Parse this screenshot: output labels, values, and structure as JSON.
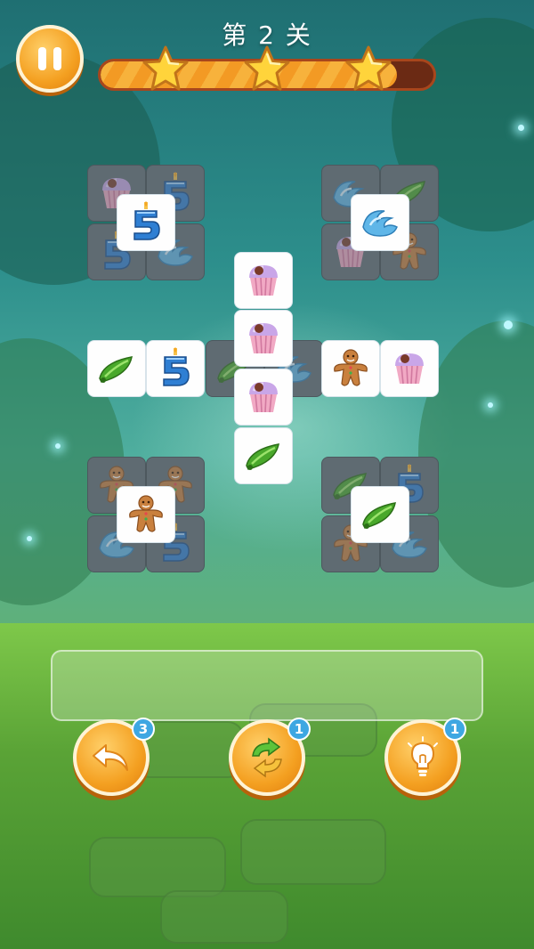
{
  "level": {
    "title": "第 2 关"
  },
  "progress": {
    "fill_fraction": 0.89,
    "stars_earned": 3,
    "stars_total": 3
  },
  "tile_types": [
    "cupcake",
    "candle-number-five",
    "water-splash",
    "pea-pod",
    "gingerbread-man"
  ],
  "tools": [
    {
      "name": "undo",
      "icon": "undo-arrow-icon",
      "count": "3"
    },
    {
      "name": "shuffle",
      "icon": "shuffle-arrows-icon",
      "count": "1"
    },
    {
      "name": "hint",
      "icon": "lightbulb-icon",
      "count": "1"
    }
  ],
  "tray": {
    "slots_filled": 0
  },
  "colors": {
    "button_orange": "#f4a021",
    "badge_blue": "#3ea7e2",
    "progress_fill": "#f39a24"
  }
}
